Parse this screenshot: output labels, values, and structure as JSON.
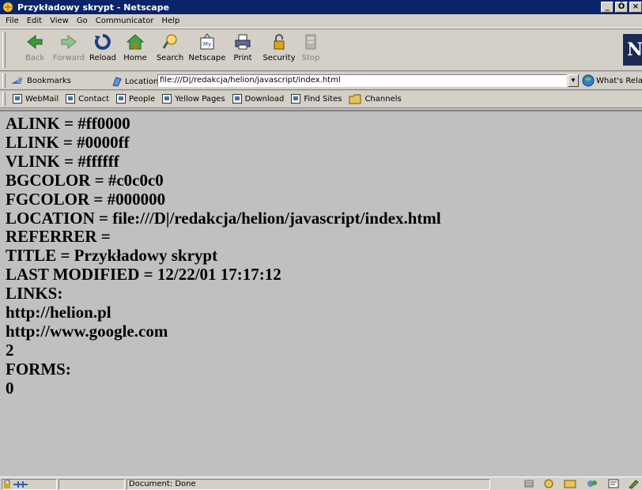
{
  "window": {
    "title": "Przykładowy skrypt - Netscape",
    "buttons": [
      "_",
      "Ô",
      "×"
    ]
  },
  "menu": [
    "File",
    "Edit",
    "View",
    "Go",
    "Communicator",
    "Help"
  ],
  "toolbar": {
    "buttons": [
      {
        "label": "Back",
        "icon": "back-arrow-icon",
        "enabled": true
      },
      {
        "label": "Forward",
        "icon": "forward-arrow-icon",
        "enabled": false
      },
      {
        "label": "Reload",
        "icon": "reload-icon",
        "enabled": true
      },
      {
        "label": "Home",
        "icon": "home-icon",
        "enabled": true
      },
      {
        "label": "Search",
        "icon": "search-icon",
        "enabled": true
      },
      {
        "label": "Netscape",
        "icon": "netscape-icon",
        "enabled": true
      },
      {
        "label": "Print",
        "icon": "printer-icon",
        "enabled": true
      },
      {
        "label": "Security",
        "icon": "padlock-icon",
        "enabled": true
      },
      {
        "label": "Stop",
        "icon": "stop-icon",
        "enabled": false
      }
    ],
    "logo": "N"
  },
  "location_bar": {
    "bookmarks_label": "Bookmarks",
    "location_label": "Location:",
    "url": "file:///D|/redakcja/helion/javascript/index.html",
    "whats_related_label": "What's Related"
  },
  "personal_toolbar": {
    "links": [
      "WebMail",
      "Contact",
      "People",
      "Yellow Pages",
      "Download",
      "Find Sites",
      "Channels"
    ]
  },
  "content": {
    "lines": [
      "ALINK = #ff0000",
      "LLINK = #0000ff",
      "VLINK = #ffffff",
      "BGCOLOR = #c0c0c0",
      "FGCOLOR = #000000",
      "LOCATION = file:///D|/redakcja/helion/javascript/index.html",
      "REFERRER =",
      "TITLE = Przykładowy skrypt",
      "LAST MODIFIED = 12/22/01 17:17:12",
      "LINKS:",
      "http://helion.pl",
      "http://www.google.com",
      "2",
      "FORMS:",
      "0"
    ]
  },
  "status_bar": {
    "text": "Document: Done"
  },
  "colors": {
    "titlebar": "#0a246a",
    "chrome": "#d4d0c8",
    "page_background": "#c0c0c0",
    "text": "#000000"
  }
}
